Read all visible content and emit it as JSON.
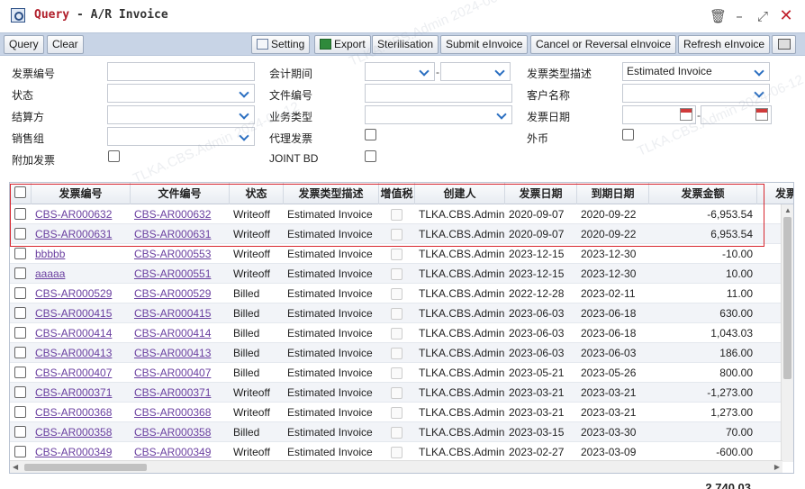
{
  "window": {
    "title_prefix": "Query",
    "title_suffix": " - A/R Invoice"
  },
  "toolbar": {
    "query": "Query",
    "clear": "Clear",
    "setting": "Setting",
    "export": "Export",
    "sterilisation": "Sterilisation",
    "submit": "Submit eInvoice",
    "cancel": "Cancel or Reversal eInvoice",
    "refresh": "Refresh eInvoice"
  },
  "form": {
    "invoice_no": "发票编号",
    "status": "状态",
    "settle": "结算方",
    "sales_group": "销售组",
    "extra_invoice": "附加发票",
    "period": "会计期间",
    "doc_no": "文件编号",
    "biz_type": "业务类型",
    "agent_invoice": "代理发票",
    "joint_bd": "JOINT BD",
    "invoice_type_desc": "发票类型描述",
    "invoice_type_value": "Estimated Invoice",
    "customer_name": "客户名称",
    "invoice_date": "发票日期",
    "foreign_currency": "外币",
    "dash": "-"
  },
  "grid": {
    "headers": [
      "发票编号",
      "文件编号",
      "状态",
      "发票类型描述",
      "增值税",
      "创建人",
      "发票日期",
      "到期日期",
      "发票金额",
      "发票"
    ],
    "rows": [
      [
        "CBS-AR000632",
        "CBS-AR000632",
        "Writeoff",
        "Estimated Invoice",
        "TLKA.CBS.Admin",
        "2020-09-07",
        "2020-09-22",
        "-6,953.54"
      ],
      [
        "CBS-AR000631",
        "CBS-AR000631",
        "Writeoff",
        "Estimated Invoice",
        "TLKA.CBS.Admin",
        "2020-09-07",
        "2020-09-22",
        "6,953.54"
      ],
      [
        "bbbbb",
        "CBS-AR000553",
        "Writeoff",
        "Estimated Invoice",
        "TLKA.CBS.Admin",
        "2023-12-15",
        "2023-12-30",
        "-10.00"
      ],
      [
        "aaaaa",
        "CBS-AR000551",
        "Writeoff",
        "Estimated Invoice",
        "TLKA.CBS.Admin",
        "2023-12-15",
        "2023-12-30",
        "10.00"
      ],
      [
        "CBS-AR000529",
        "CBS-AR000529",
        "Billed",
        "Estimated Invoice",
        "TLKA.CBS.Admin",
        "2022-12-28",
        "2023-02-11",
        "11.00"
      ],
      [
        "CBS-AR000415",
        "CBS-AR000415",
        "Billed",
        "Estimated Invoice",
        "TLKA.CBS.Admin",
        "2023-06-03",
        "2023-06-18",
        "630.00"
      ],
      [
        "CBS-AR000414",
        "CBS-AR000414",
        "Billed",
        "Estimated Invoice",
        "TLKA.CBS.Admin",
        "2023-06-03",
        "2023-06-18",
        "1,043.03"
      ],
      [
        "CBS-AR000413",
        "CBS-AR000413",
        "Billed",
        "Estimated Invoice",
        "TLKA.CBS.Admin",
        "2023-06-03",
        "2023-06-03",
        "186.00"
      ],
      [
        "CBS-AR000407",
        "CBS-AR000407",
        "Billed",
        "Estimated Invoice",
        "TLKA.CBS.Admin",
        "2023-05-21",
        "2023-05-26",
        "800.00"
      ],
      [
        "CBS-AR000371",
        "CBS-AR000371",
        "Writeoff",
        "Estimated Invoice",
        "TLKA.CBS.Admin",
        "2023-03-21",
        "2023-03-21",
        "-1,273.00"
      ],
      [
        "CBS-AR000368",
        "CBS-AR000368",
        "Writeoff",
        "Estimated Invoice",
        "TLKA.CBS.Admin",
        "2023-03-21",
        "2023-03-21",
        "1,273.00"
      ],
      [
        "CBS-AR000358",
        "CBS-AR000358",
        "Billed",
        "Estimated Invoice",
        "TLKA.CBS.Admin",
        "2023-03-15",
        "2023-03-30",
        "70.00"
      ],
      [
        "CBS-AR000349",
        "CBS-AR000349",
        "Writeoff",
        "Estimated Invoice",
        "TLKA.CBS.Admin",
        "2023-02-27",
        "2023-03-09",
        "-600.00"
      ]
    ],
    "total": "2,740.03"
  },
  "watermark": "TLKA.CBS.Admin 2024-06-12",
  "colors": {
    "accent": "#b01e2a",
    "toolbar": "#c8d4e6",
    "link": "#6a3fa0",
    "highlight": "#d7262f"
  }
}
